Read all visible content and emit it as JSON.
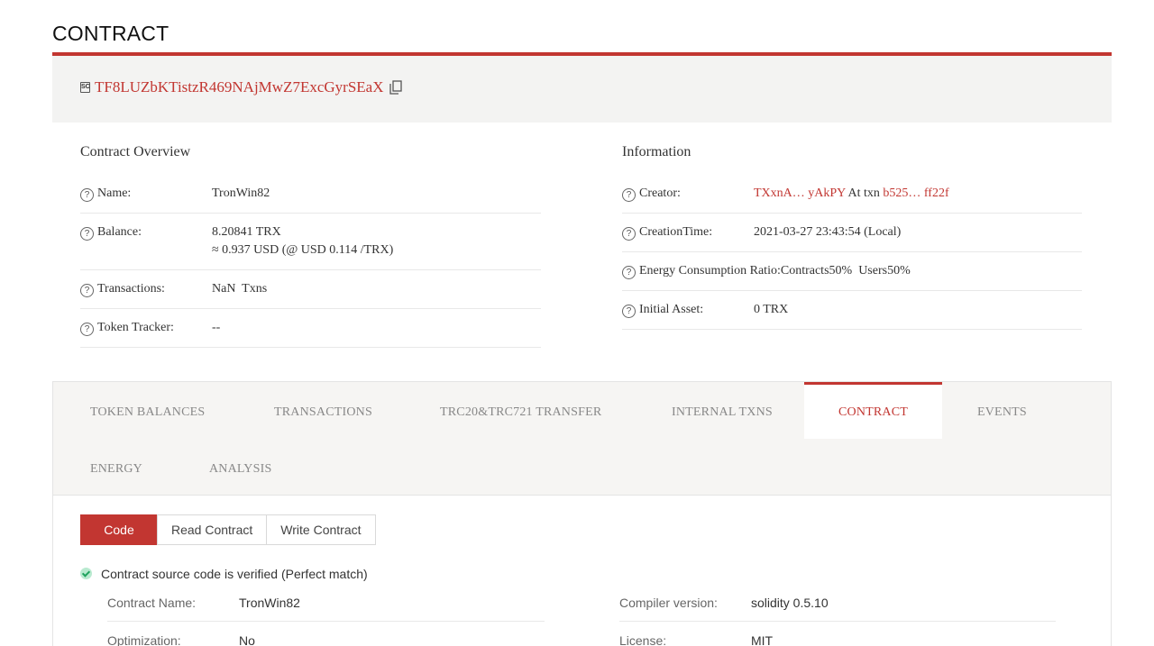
{
  "page": {
    "title": "CONTRACT"
  },
  "address": {
    "value": "TF8LUZbKTistzR469NAjMwZ7ExcGyrSEaX",
    "icon": "contract-icon",
    "copy_icon": "copy-icon"
  },
  "overview": {
    "title": "Contract Overview",
    "rows": [
      {
        "label": "Name:",
        "value": "TronWin82"
      },
      {
        "label": "Balance:",
        "value": "8.20841 TRX",
        "sub": "≈ 0.937 USD (@ USD 0.114 /TRX)"
      },
      {
        "label": "Transactions:",
        "value": "NaN  Txns"
      },
      {
        "label": "Token Tracker:",
        "value": "--"
      }
    ]
  },
  "information": {
    "title": "Information",
    "creator": {
      "label": "Creator:",
      "address": "TXxnA… yAkPY",
      "at_txn": "At txn",
      "txn": "b525… ff22f"
    },
    "creation_time": {
      "label": "CreationTime:",
      "value": "2021-03-27 23:43:54 (Local)"
    },
    "energy": {
      "label": "Energy Consumption Ratio:",
      "contracts": "Contracts50%",
      "users": "Users50%"
    },
    "initial_asset": {
      "label": "Initial Asset:",
      "value": "0 TRX"
    }
  },
  "tabs": [
    {
      "label": "TOKEN BALANCES"
    },
    {
      "label": "TRANSACTIONS"
    },
    {
      "label": "TRC20&TRC721 TRANSFER"
    },
    {
      "label": "INTERNAL TXNS"
    },
    {
      "label": "CONTRACT"
    },
    {
      "label": "EVENTS"
    },
    {
      "label": "ENERGY"
    },
    {
      "label": "ANALYSIS"
    }
  ],
  "active_tab": "CONTRACT",
  "contract_buttons": [
    {
      "label": "Code"
    },
    {
      "label": "Read Contract"
    },
    {
      "label": "Write Contract"
    }
  ],
  "verified_text": "Contract source code is verified (Perfect match)",
  "contract_info": {
    "name": {
      "label": "Contract Name:",
      "value": "TronWin82"
    },
    "compiler": {
      "label": "Compiler version:",
      "value": "solidity 0.5.10"
    },
    "optimization": {
      "label": "Optimization:",
      "value": "No"
    },
    "license": {
      "label": "License:",
      "value": "MIT"
    }
  },
  "colors": {
    "accent": "#c23631",
    "verified": "#21a35f"
  }
}
